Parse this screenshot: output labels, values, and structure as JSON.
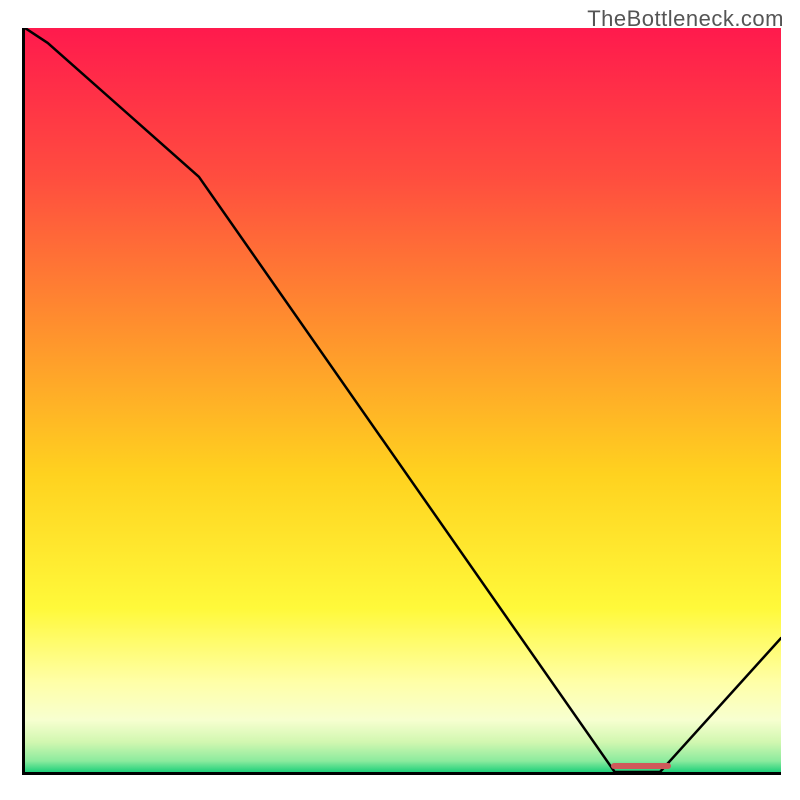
{
  "watermark": "TheBottleneck.com",
  "chart_data": {
    "type": "line",
    "title": "",
    "xlabel": "",
    "ylabel": "",
    "x": [
      0.0,
      0.03,
      0.23,
      0.78,
      0.84,
      1.0
    ],
    "values": [
      1.0,
      0.98,
      0.8,
      0.0,
      0.0,
      0.18
    ],
    "xlim": [
      0,
      1
    ],
    "ylim": [
      0,
      1
    ],
    "marker_highlight": {
      "x_start": 0.775,
      "x_end": 0.855,
      "y": 0.008
    },
    "background_gradient_stops": [
      {
        "offset": 0.0,
        "color": "#ff1a4d"
      },
      {
        "offset": 0.2,
        "color": "#ff4d3f"
      },
      {
        "offset": 0.4,
        "color": "#ff8f2e"
      },
      {
        "offset": 0.6,
        "color": "#ffd21f"
      },
      {
        "offset": 0.78,
        "color": "#fff93a"
      },
      {
        "offset": 0.88,
        "color": "#ffffa8"
      },
      {
        "offset": 0.93,
        "color": "#f7ffd0"
      },
      {
        "offset": 0.96,
        "color": "#d1f7b0"
      },
      {
        "offset": 0.985,
        "color": "#8ceb9e"
      },
      {
        "offset": 1.0,
        "color": "#1fd07a"
      }
    ]
  },
  "colors": {
    "line": "#000000",
    "marker": "#cf5a5a",
    "axis": "#000000",
    "watermark": "#555555"
  }
}
